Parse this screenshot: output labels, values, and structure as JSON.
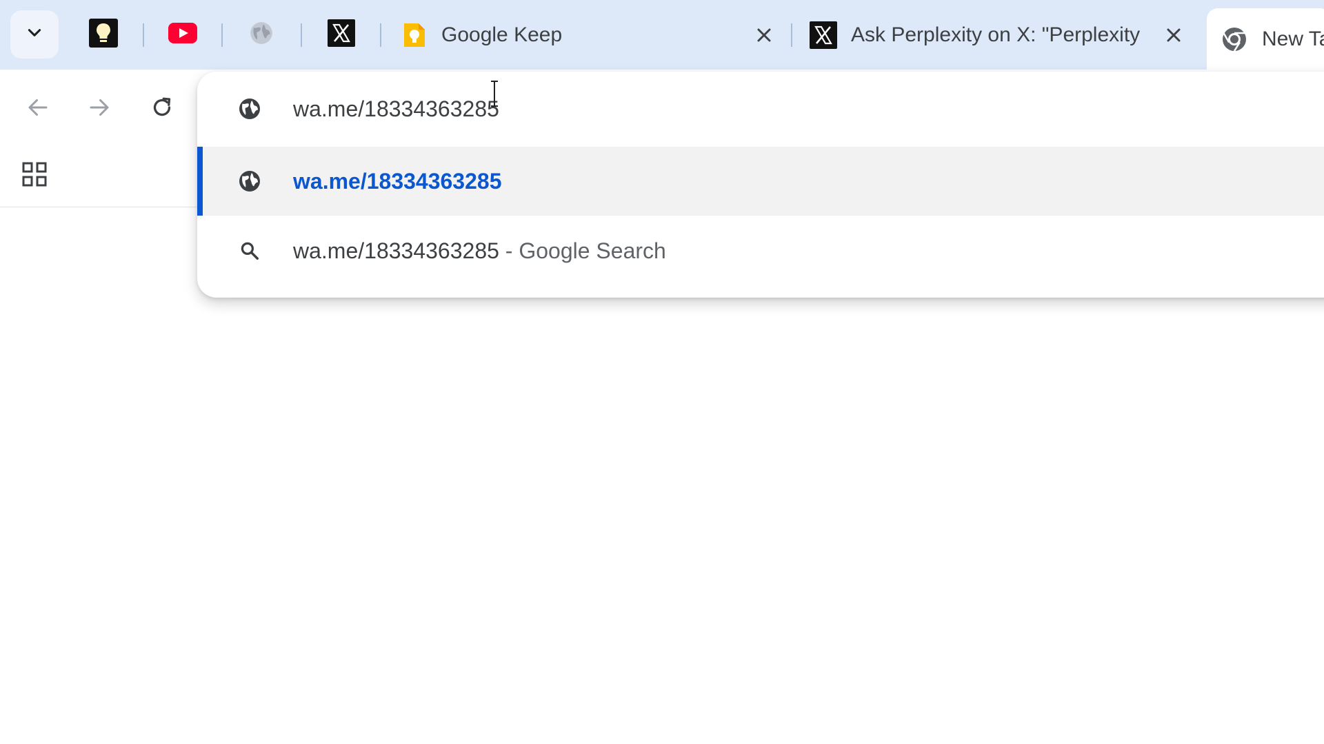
{
  "tabstrip": {
    "tab_search_icon": "chevron-down-icon",
    "pinned_tabs": [
      {
        "name": "keep-pinned",
        "icon": "lightbulb-icon"
      },
      {
        "name": "youtube-pinned",
        "icon": "youtube-icon"
      },
      {
        "name": "globe-pinned",
        "icon": "globe-icon"
      },
      {
        "name": "x-pinned",
        "icon": "x-logo-icon"
      }
    ],
    "tabs": [
      {
        "title": "Google Keep",
        "icon": "google-keep-icon",
        "close": "×"
      },
      {
        "title": "Ask Perplexity on X: \"Perplexity",
        "icon": "x-logo-icon",
        "close": "×"
      },
      {
        "title": "New Ta",
        "icon": "chrome-icon",
        "active": true
      }
    ]
  },
  "toolbar": {
    "back_icon": "arrow-left-icon",
    "forward_icon": "arrow-right-icon",
    "reload_icon": "reload-icon",
    "apps_icon": "apps-grid-icon"
  },
  "omnibox": {
    "input_value": "wa.me/18334363285",
    "suggestions": [
      {
        "text": "wa.me/18334363285",
        "icon": "globe-icon",
        "selected": true
      },
      {
        "text": "wa.me/18334363285",
        "suffix": " - Google Search",
        "icon": "search-icon",
        "selected": false
      }
    ]
  },
  "colors": {
    "tabstrip_bg": "#dde8f8",
    "accent_blue": "#0b57d0",
    "youtube_red": "#ff0033",
    "keep_yellow": "#fbbc04"
  }
}
